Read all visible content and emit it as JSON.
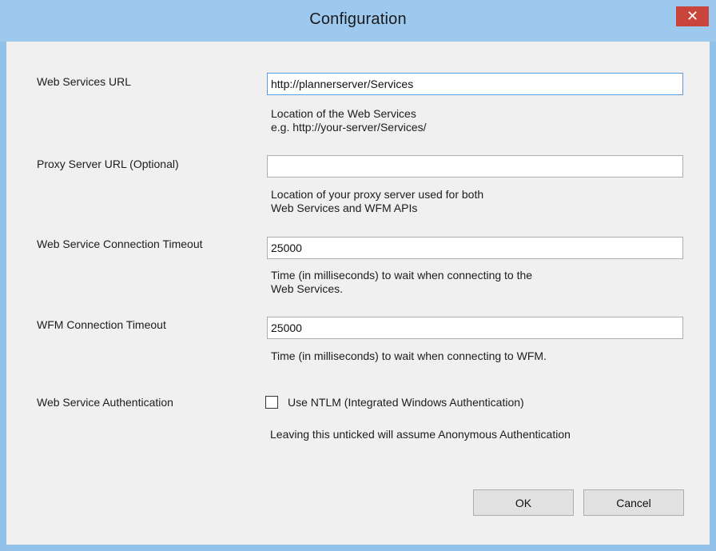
{
  "window": {
    "title": "Configuration",
    "close_glyph": "✕"
  },
  "web_services_url": {
    "label": "Web Services URL",
    "value": "http://plannerserver/Services",
    "hint_line1": "Location of the Web Services",
    "hint_line2": "e.g. http://your-server/Services/"
  },
  "proxy_server_url": {
    "label": "Proxy Server URL (Optional)",
    "value": "",
    "hint_line1": "Location of your proxy server used for both",
    "hint_line2": "Web Services and WFM APIs"
  },
  "web_service_timeout": {
    "label": "Web Service Connection Timeout",
    "value": "25000",
    "hint_line1": "Time (in milliseconds) to wait when connecting to the",
    "hint_line2": "Web Services."
  },
  "wfm_timeout": {
    "label": "WFM Connection Timeout",
    "value": "25000",
    "hint_line1": "Time (in milliseconds) to wait when connecting to WFM."
  },
  "authentication": {
    "label": "Web Service Authentication",
    "checkbox_label": "Use NTLM (Integrated Windows Authentication)",
    "checked": false,
    "hint_line1": "Leaving this unticked will assume Anonymous Authentication"
  },
  "buttons": {
    "ok": "OK",
    "cancel": "Cancel"
  },
  "colors": {
    "titlebar": "#9dc9ef",
    "close_button": "#c9453b",
    "dialog_background": "#f0f0f0"
  }
}
